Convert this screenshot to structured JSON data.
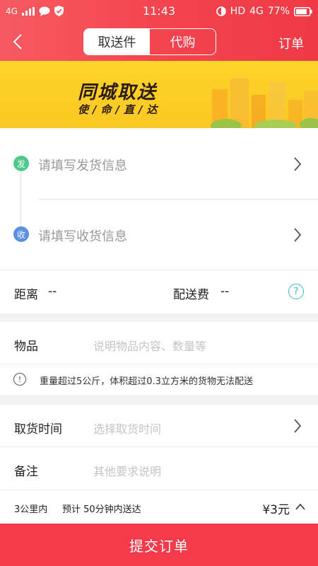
{
  "status_bar": {
    "network": "4G",
    "time": "11:43",
    "hd": "HD",
    "net2": "4G",
    "battery": "77%"
  },
  "nav": {
    "tabs": [
      {
        "label": "取送件",
        "active": true
      },
      {
        "label": "代购",
        "active": false
      }
    ],
    "order_label": "订单"
  },
  "banner": {
    "title": "同城取送",
    "subtitle": "使/命/直/达"
  },
  "address": {
    "send_badge": "发",
    "send_placeholder": "请填写发货信息",
    "recv_badge": "收",
    "recv_placeholder": "请填写收货信息"
  },
  "distance": {
    "distance_label": "距离",
    "distance_value": "--",
    "fee_label": "配送费",
    "fee_value": "--",
    "help_glyph": "?"
  },
  "goods": {
    "label": "物品",
    "placeholder": "说明物品内容、数量等",
    "warning_glyph": "!",
    "warning": "重量超过5公斤，体积超过0.3立方米的货物无法配送"
  },
  "pickup": {
    "time_label": "取货时间",
    "time_placeholder": "选择取货时间",
    "remark_label": "备注",
    "remark_placeholder": "其他要求说明"
  },
  "summary": {
    "range": "3公里内",
    "eta": "预计 50分钟内送达",
    "price": "¥3元"
  },
  "submit_label": "提交订单",
  "colors": {
    "header": "#f3434e",
    "submit": "#f43a4b",
    "send_dot": "#4fc98b",
    "recv_dot": "#5b8fe0",
    "help": "#3bb7c9",
    "banner": "#fcc823"
  }
}
